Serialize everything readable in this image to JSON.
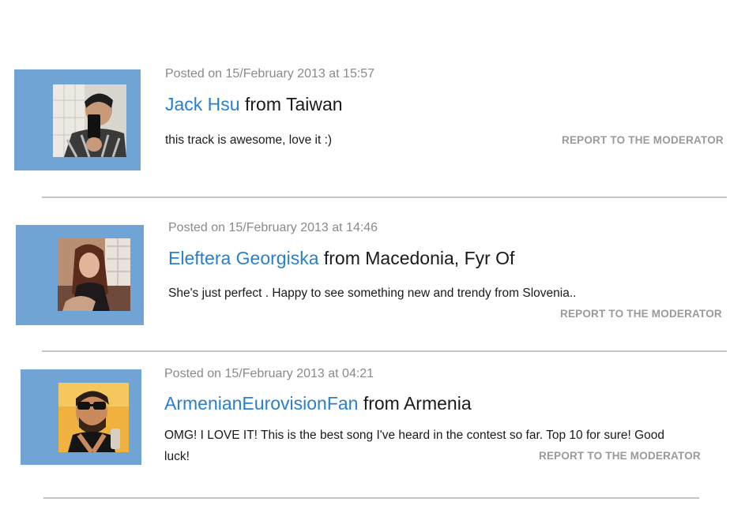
{
  "comments": [
    {
      "posted": "Posted on 15/February 2013 at 15:57",
      "username": "Jack Hsu",
      "from_label": "from Taiwan",
      "text": "this track is awesome, love it :)",
      "report_label": "REPORT TO THE MODERATOR"
    },
    {
      "posted": "Posted on 15/February 2013 at 14:46",
      "username": "Eleftera Georgiska",
      "from_label": "from Macedonia, Fyr Of",
      "text": "She's just perfect . Happy to see something new and trendy from Slovenia..",
      "report_label": "REPORT TO THE MODERATOR"
    },
    {
      "posted": "Posted on 15/February 2013 at 04:21",
      "username": "ArmenianEurovisionFan",
      "from_label": "from Armenia",
      "text": "OMG! I LOVE IT! This is the best song I've heard in the contest so far. Top 10 for sure! Good luck!",
      "report_label": "REPORT TO THE MODERATOR"
    }
  ],
  "colors": {
    "avatar_frame": "#6fa4d4",
    "username": "#2a7fcc",
    "meta": "#8a8a8a",
    "report": "#9a9a9a",
    "divider": "#c4c4c4"
  }
}
